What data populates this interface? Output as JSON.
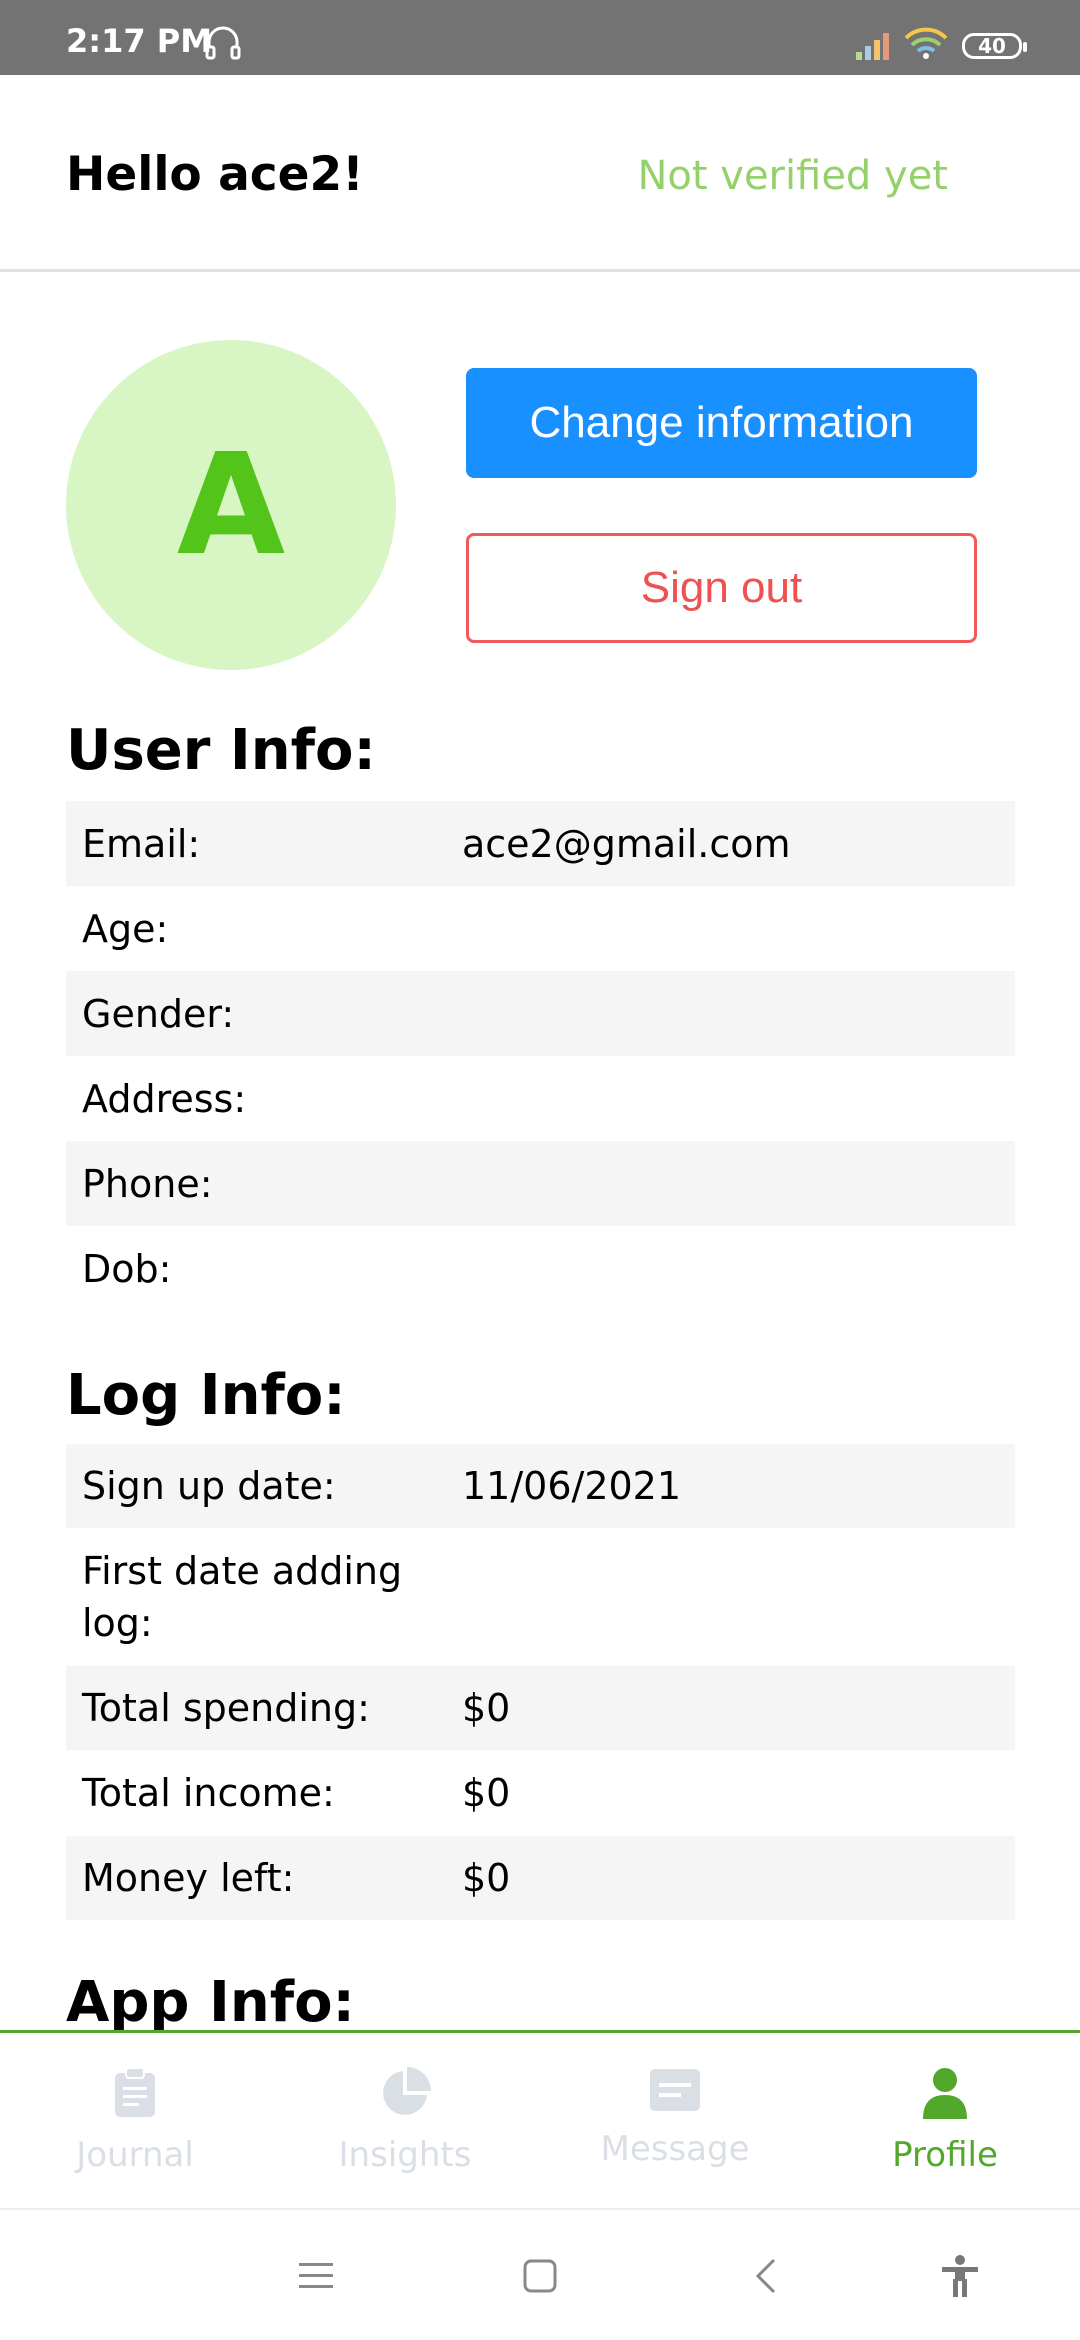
{
  "status_bar": {
    "time": "2:17 PM",
    "battery": "40",
    "icons": [
      "headset-icon",
      "signal-icon",
      "wifi-icon",
      "battery-icon"
    ]
  },
  "header": {
    "greeting": "Hello ace2!",
    "verification_status": "Not verified yet"
  },
  "profile": {
    "avatar_letter": "A",
    "change_info_label": "Change information",
    "sign_out_label": "Sign out"
  },
  "user_info": {
    "title": "User Info:",
    "rows": [
      {
        "label": "Email:",
        "value": "ace2@gmail.com"
      },
      {
        "label": "Age:",
        "value": ""
      },
      {
        "label": "Gender:",
        "value": ""
      },
      {
        "label": "Address:",
        "value": ""
      },
      {
        "label": "Phone:",
        "value": ""
      },
      {
        "label": "Dob:",
        "value": ""
      }
    ]
  },
  "log_info": {
    "title": "Log Info:",
    "rows": [
      {
        "label": "Sign up date:",
        "value": "11/06/2021"
      },
      {
        "label": "First date adding log:",
        "value": ""
      },
      {
        "label": "Total spending:",
        "value": "$0"
      },
      {
        "label": "Total income:",
        "value": "$0"
      },
      {
        "label": "Money left:",
        "value": "$0"
      }
    ]
  },
  "app_info": {
    "title": "App Info:"
  },
  "bottom_nav": {
    "tabs": [
      {
        "label": "Journal",
        "icon": "clipboard-icon"
      },
      {
        "label": "Insights",
        "icon": "pie-chart-icon"
      },
      {
        "label": "Message",
        "icon": "message-icon"
      },
      {
        "label": "Profile",
        "icon": "person-icon"
      }
    ],
    "active": "Profile"
  },
  "colors": {
    "accent_green": "#52a82a",
    "primary_blue": "#1890ff",
    "danger_red": "#f05050",
    "avatar_bg": "#d8f5c4",
    "verify_green": "#95d16a"
  }
}
